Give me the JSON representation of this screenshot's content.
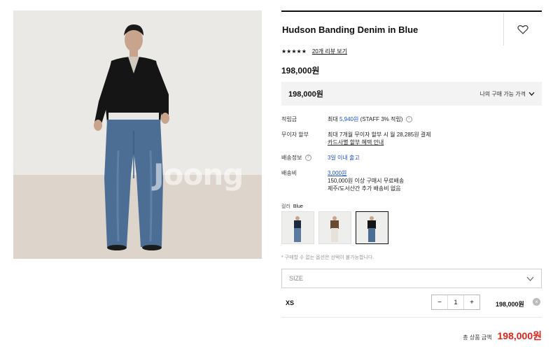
{
  "product": {
    "title": "Hudson Banding Denim in Blue",
    "rating_stars": "★★★★★",
    "review_link": "20개 리뷰 보기",
    "price": "198,000원",
    "image_watermark": "Joong"
  },
  "price_bar": {
    "value": "198,000원",
    "lowest_price_label": "나의 구매 가능 가격"
  },
  "info": {
    "points_label": "적립금",
    "points_prefix": "최대",
    "points_value": "5,940원",
    "points_suffix": "(STAFF 3% 적립)",
    "installment_label": "무이자 할부",
    "installment_text": "최대 7개월 무이자 할부 시 월 28,285원 결제",
    "installment_link": "카드사별 할부 혜택 안내",
    "delivery_label": "배송정보",
    "delivery_value": "3일 이내 출고",
    "shipping_label": "배송비",
    "shipping_value": "3,000원",
    "shipping_note1": "150,000원 이상 구매시 무료배송",
    "shipping_note2": "제주/도서산간 추가 배송비 없음"
  },
  "color": {
    "label": "컬러",
    "selected": "Blue"
  },
  "option_note": "* 구매할 수 없는 옵션은 선택이 불가능합니다.",
  "size_select": {
    "placeholder": "SIZE"
  },
  "selected_item": {
    "size": "XS",
    "minus": "−",
    "quantity": "1",
    "plus": "+",
    "line_price": "198,000원",
    "remove": "×"
  },
  "total": {
    "label": "총 상품 금액",
    "amount": "198,000원"
  },
  "colors": {
    "accent_blue": "#1a4fc9",
    "total_red": "#e0241b",
    "denim": "#4c6e95"
  }
}
